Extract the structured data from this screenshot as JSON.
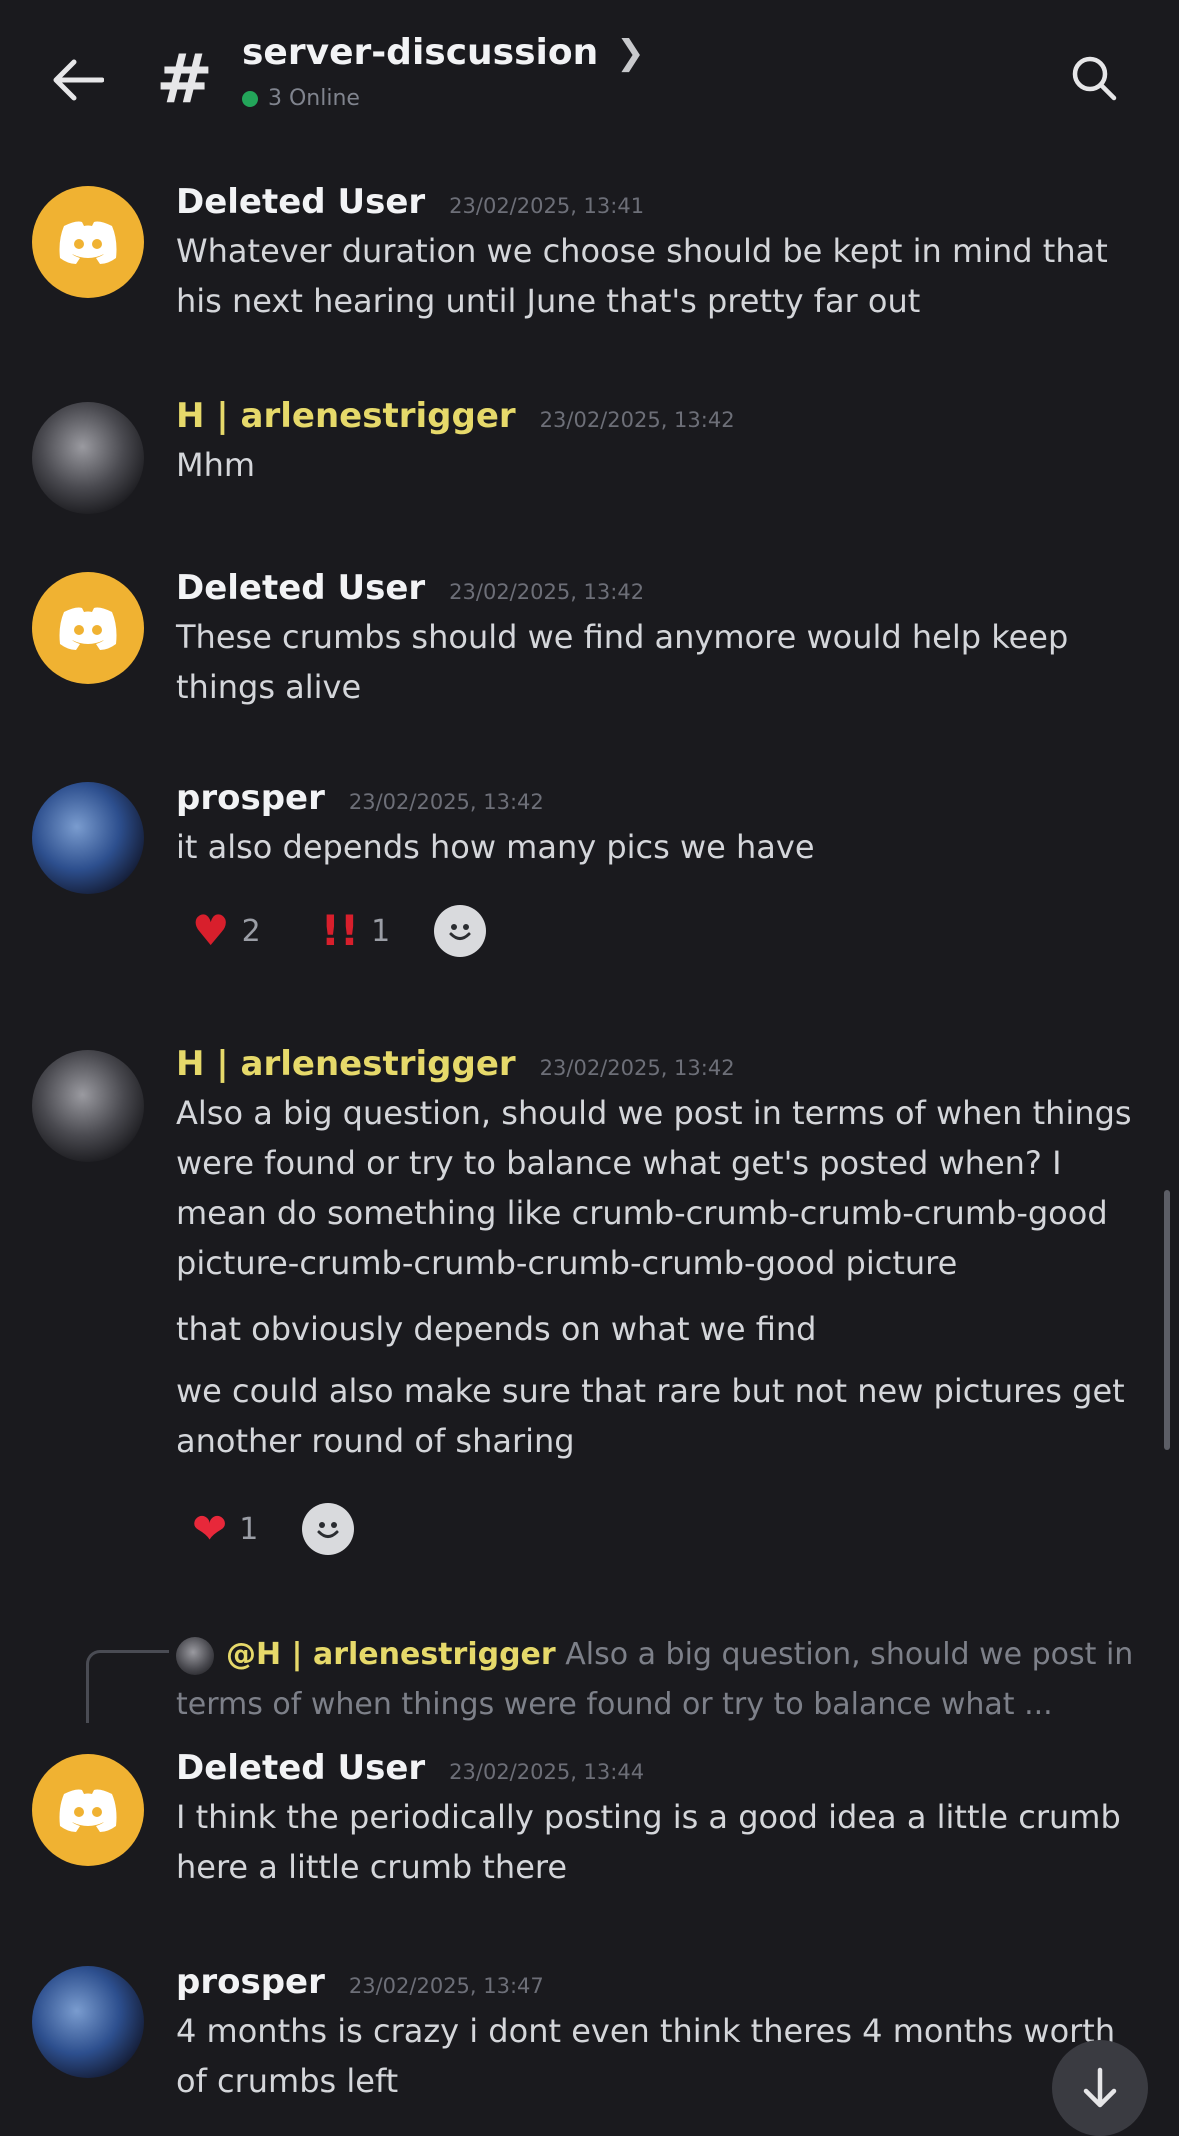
{
  "header": {
    "channel_name": "server-discussion",
    "online_status": "3 Online",
    "icons": [
      "back-arrow-icon",
      "hash-icon",
      "chevron-right-icon",
      "search-icon"
    ]
  },
  "colors": {
    "background": "#1a1a1e",
    "deleted_user_avatar": "#f0b232",
    "role_name_color": "#e6d96a",
    "online_dot": "#23a55a"
  },
  "messages": [
    {
      "author": "Deleted User",
      "timestamp": "23/02/2025, 13:41",
      "text": "Whatever duration we choose should be kept in mind that his next hearing until June that's pretty far out"
    },
    {
      "author": "H | arlenestrigger",
      "timestamp": "23/02/2025, 13:42",
      "text": "Mhm"
    },
    {
      "author": "Deleted User",
      "timestamp": "23/02/2025, 13:42",
      "text": "These crumbs should we find anymore would help keep things alive"
    },
    {
      "author": "prosper",
      "timestamp": "23/02/2025, 13:42",
      "text": "it also depends how many pics we have",
      "reactions": [
        {
          "emoji": "heart",
          "count": "2"
        },
        {
          "emoji": "double-exclamation",
          "count": "1"
        }
      ]
    },
    {
      "author": "H | arlenestrigger",
      "timestamp": "23/02/2025, 13:42",
      "text": "Also a big question, should we post in terms of when things were found or try to balance what get's posted when? I mean do something like crumb-crumb-crumb-crumb-good picture-crumb-crumb-crumb-crumb-good picture",
      "text2": "that obviously depends on what we find",
      "text3": "we could also make sure that rare but not new pictures get another round of sharing",
      "reactions": [
        {
          "emoji": "heart",
          "count": "1"
        }
      ]
    },
    {
      "reply_to_mention": "@H | arlenestrigger",
      "reply_preview": "Also a big question, should we post in terms of when things were found or try to balance what ...",
      "author": "Deleted User",
      "timestamp": "23/02/2025, 13:44",
      "text": "I think the periodically posting is a good idea a little crumb here a little crumb there"
    },
    {
      "author": "prosper",
      "timestamp": "23/02/2025, 13:47",
      "text": "4 months is crazy i dont even think theres 4 months worth of crumbs left"
    }
  ]
}
